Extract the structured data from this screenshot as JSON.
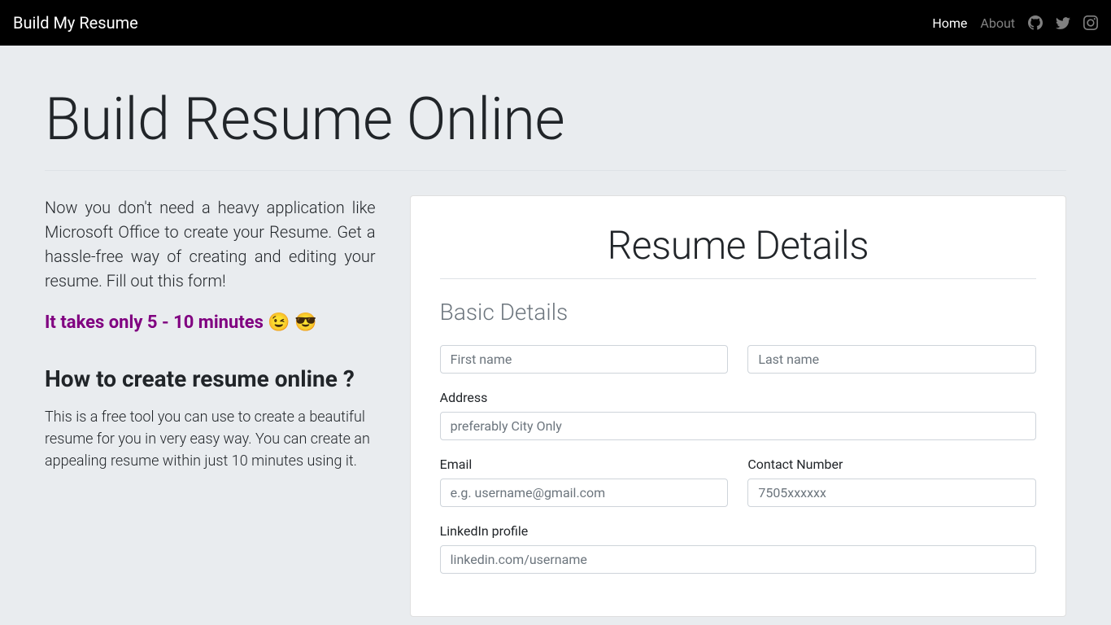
{
  "nav": {
    "brand": "Build My Resume",
    "home": "Home",
    "about": "About"
  },
  "hero": {
    "title": "Build Resume Online",
    "intro": "Now you don't need a heavy application like Microsoft Office to create your Resume. Get a hassle-free way of creating and editing your resume. Fill out this form!",
    "time": "It takes only 5 - 10 minutes 😉  😎",
    "how_title": "How to create resume online ?",
    "how_text": "This is a free tool you can use to create a beautiful resume for you in very easy way. You can create an appealing resume within just 10 minutes using it."
  },
  "form": {
    "card_title": "Resume Details",
    "section_basic": "Basic Details",
    "placeholders": {
      "fname": "First name",
      "lname": "Last name",
      "address": "preferably City Only",
      "email": "e.g. username@gmail.com",
      "contact": "7505xxxxxx",
      "linkedin": "linkedin.com/username"
    },
    "labels": {
      "address": "Address",
      "email": "Email",
      "contact": "Contact Number",
      "linkedin": "LinkedIn profile"
    }
  }
}
